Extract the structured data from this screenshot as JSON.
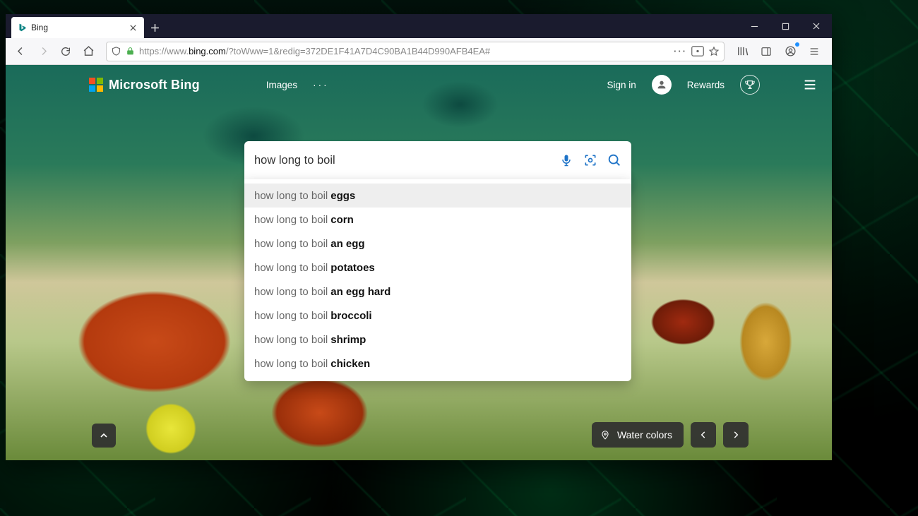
{
  "browser": {
    "tab_title": "Bing",
    "url": {
      "scheme": "https://www.",
      "host": "bing.com",
      "path": "/?toWww=1&redig=372DE1F41A7D4C90BA1B44D990AFB4EA#"
    }
  },
  "bing": {
    "brand": "Microsoft Bing",
    "nav": {
      "images": "Images"
    },
    "signin": "Sign in",
    "rewards": "Rewards",
    "caption": "Water colors"
  },
  "search": {
    "query": "how long to boil",
    "placeholder": "",
    "suggestions": [
      {
        "prefix": "how long to boil",
        "completion": "eggs"
      },
      {
        "prefix": "how long to boil",
        "completion": "corn"
      },
      {
        "prefix": "how long to boil",
        "completion": "an egg"
      },
      {
        "prefix": "how long to boil",
        "completion": "potatoes"
      },
      {
        "prefix": "how long to boil",
        "completion": "an egg hard"
      },
      {
        "prefix": "how long to boil",
        "completion": "broccoli"
      },
      {
        "prefix": "how long to boil",
        "completion": "shrimp"
      },
      {
        "prefix": "how long to boil",
        "completion": "chicken"
      }
    ]
  }
}
